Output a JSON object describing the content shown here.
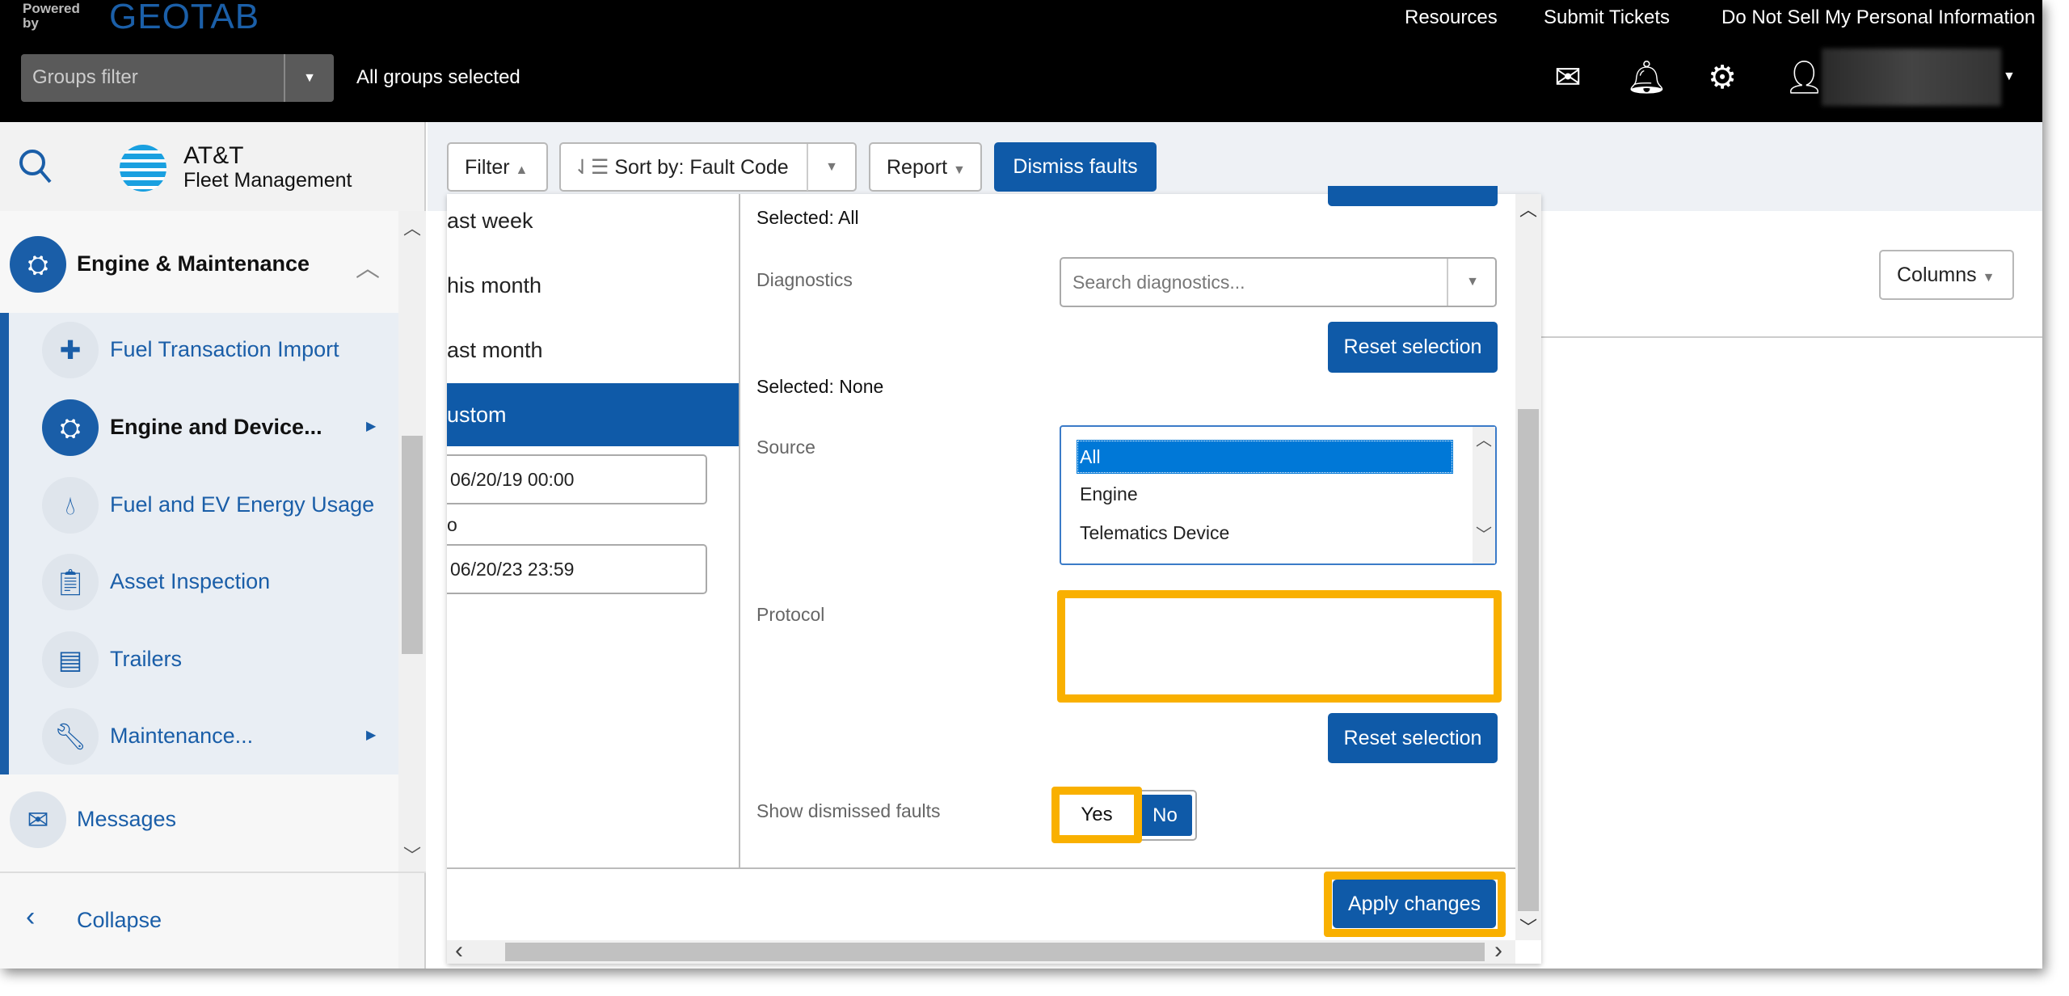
{
  "topbar": {
    "powered_by": "Powered by",
    "brand": "GEOTAB",
    "links": [
      "Resources",
      "Submit Tickets",
      "Do Not Sell My Personal Information"
    ],
    "groups_filter_placeholder": "Groups filter",
    "groups_status": "All groups selected",
    "icons": [
      "mail-icon",
      "bell-icon",
      "gear-icon",
      "user-icon"
    ]
  },
  "sidebar": {
    "logo_line1": "AT&T",
    "logo_line2": "Fleet Management",
    "section": "Engine & Maintenance",
    "items": [
      {
        "label": "Fuel Transaction Import",
        "icon": "puzzle-icon"
      },
      {
        "label": "Engine and Device...",
        "icon": "engine-icon"
      },
      {
        "label": "Fuel and EV Energy Usage",
        "icon": "fuel-icon"
      },
      {
        "label": "Asset Inspection",
        "icon": "clipboard-icon"
      },
      {
        "label": "Trailers",
        "icon": "trailer-icon"
      },
      {
        "label": "Maintenance...",
        "icon": "wrench-icon"
      }
    ],
    "messages": "Messages",
    "collapse": "Collapse"
  },
  "toolbar": {
    "filter": "Filter",
    "sort_prefix": "Sort by:",
    "sort_value": "Fault Code",
    "report": "Report",
    "dismiss": "Dismiss faults",
    "columns": "Columns"
  },
  "filter_panel": {
    "date_options": [
      "ast week",
      "his month",
      "ast month",
      "ustom"
    ],
    "from_value": "06/20/19 00:00",
    "to_label": "o",
    "to_value": "06/20/23 23:59",
    "selected_all": "Selected: All",
    "diagnostics_label": "Diagnostics",
    "diagnostics_placeholder": "Search diagnostics...",
    "reset_selection": "Reset selection",
    "selected_none": "Selected: None",
    "source_label": "Source",
    "source_options": [
      "All",
      "Engine",
      "Telematics Device"
    ],
    "source_selected": "All",
    "protocol_label": "Protocol",
    "show_dismissed_label": "Show dismissed faults",
    "yes": "Yes",
    "no": "No",
    "apply": "Apply changes"
  },
  "colors": {
    "accent": "#0f5aa8",
    "highlight": "#f9b000",
    "selected_option": "#0078d7"
  }
}
